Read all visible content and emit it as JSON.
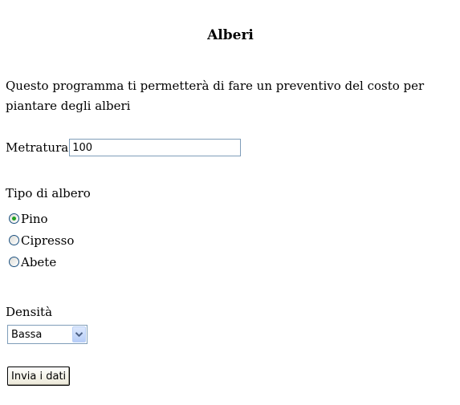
{
  "page": {
    "title": "Alberi",
    "intro": "Questo programma ti permetterà di fare un preventivo del costo per piantare degli alberi"
  },
  "form": {
    "metratura": {
      "label": "Metratura",
      "value": "100"
    },
    "tipo": {
      "label": "Tipo di albero",
      "options": [
        {
          "label": "Pino",
          "checked": true
        },
        {
          "label": "Cipresso",
          "checked": false
        },
        {
          "label": "Abete",
          "checked": false
        }
      ]
    },
    "densita": {
      "label": "Densità",
      "selected": "Bassa",
      "arrow_icon": "chevron-down-icon"
    },
    "submit_label": "Invia i dati"
  },
  "colors": {
    "input_border": "#7f9db9",
    "radio_dot": "#21a121",
    "dropdown_arrow": "#4d6185"
  }
}
